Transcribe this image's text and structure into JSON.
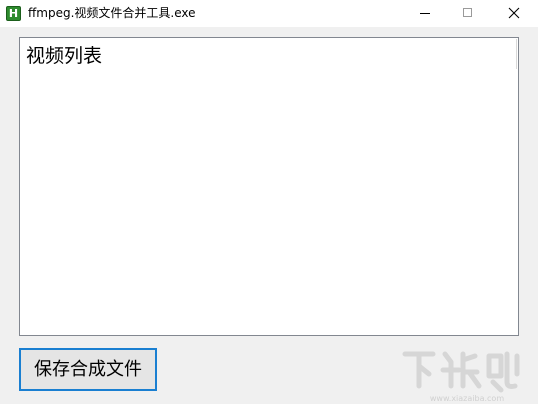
{
  "window": {
    "title": "ffmpeg.视频文件合并工具.exe",
    "icon_letter": "H"
  },
  "video_list": {
    "header": "视频列表",
    "items": []
  },
  "actions": {
    "save_label": "保存合成文件"
  },
  "watermark": {
    "text": "下载吧",
    "url": "www.xiazaiba.com"
  },
  "colors": {
    "window_bg": "#f0f0f0",
    "titlebar_bg": "#ffffff",
    "button_focus_border": "#1a7fd1",
    "app_icon_green": "#2e8b2e"
  }
}
